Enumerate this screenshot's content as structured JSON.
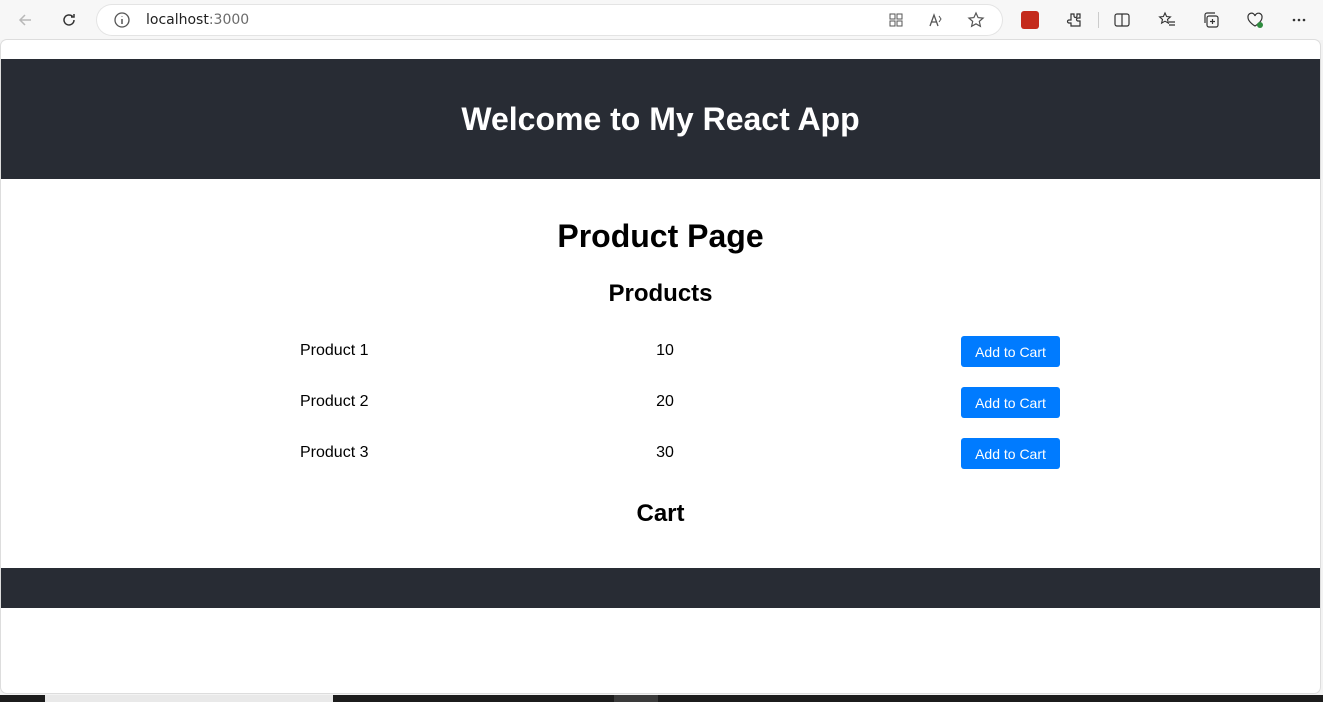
{
  "browser": {
    "url_host": "localhost",
    "url_port": ":3000"
  },
  "header": {
    "title": "Welcome to My React App"
  },
  "main": {
    "page_title": "Product Page",
    "products_heading": "Products",
    "products": [
      {
        "name": "Product 1",
        "price": "10",
        "button_label": "Add to Cart"
      },
      {
        "name": "Product 2",
        "price": "20",
        "button_label": "Add to Cart"
      },
      {
        "name": "Product 3",
        "price": "30",
        "button_label": "Add to Cart"
      }
    ],
    "cart_heading": "Cart"
  },
  "colors": {
    "header_bg": "#282c34",
    "button_bg": "#007bff"
  }
}
